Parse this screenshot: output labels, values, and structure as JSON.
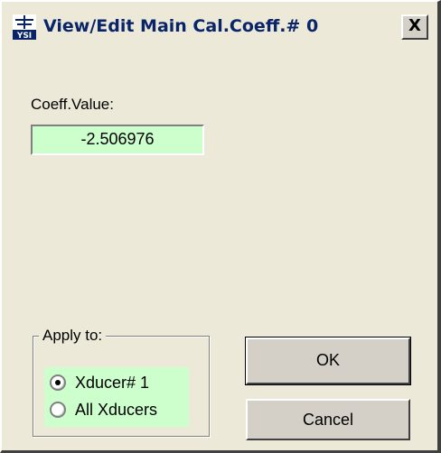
{
  "window": {
    "title": "View/Edit Main Cal.Coeff.# 0",
    "close_label": "X",
    "app_icon_text": "YSI"
  },
  "coeff": {
    "label": "Coeff.Value:",
    "value": "-2.506976"
  },
  "apply_group": {
    "legend": "Apply to:",
    "options": [
      {
        "label": "Xducer# 1",
        "checked": true
      },
      {
        "label": "All Xducers",
        "checked": false
      }
    ]
  },
  "buttons": {
    "ok": "OK",
    "cancel": "Cancel"
  },
  "colors": {
    "field_bg": "#ccffcc",
    "dialog_bg": "#ece9d8",
    "title_text": "#0a246a"
  }
}
